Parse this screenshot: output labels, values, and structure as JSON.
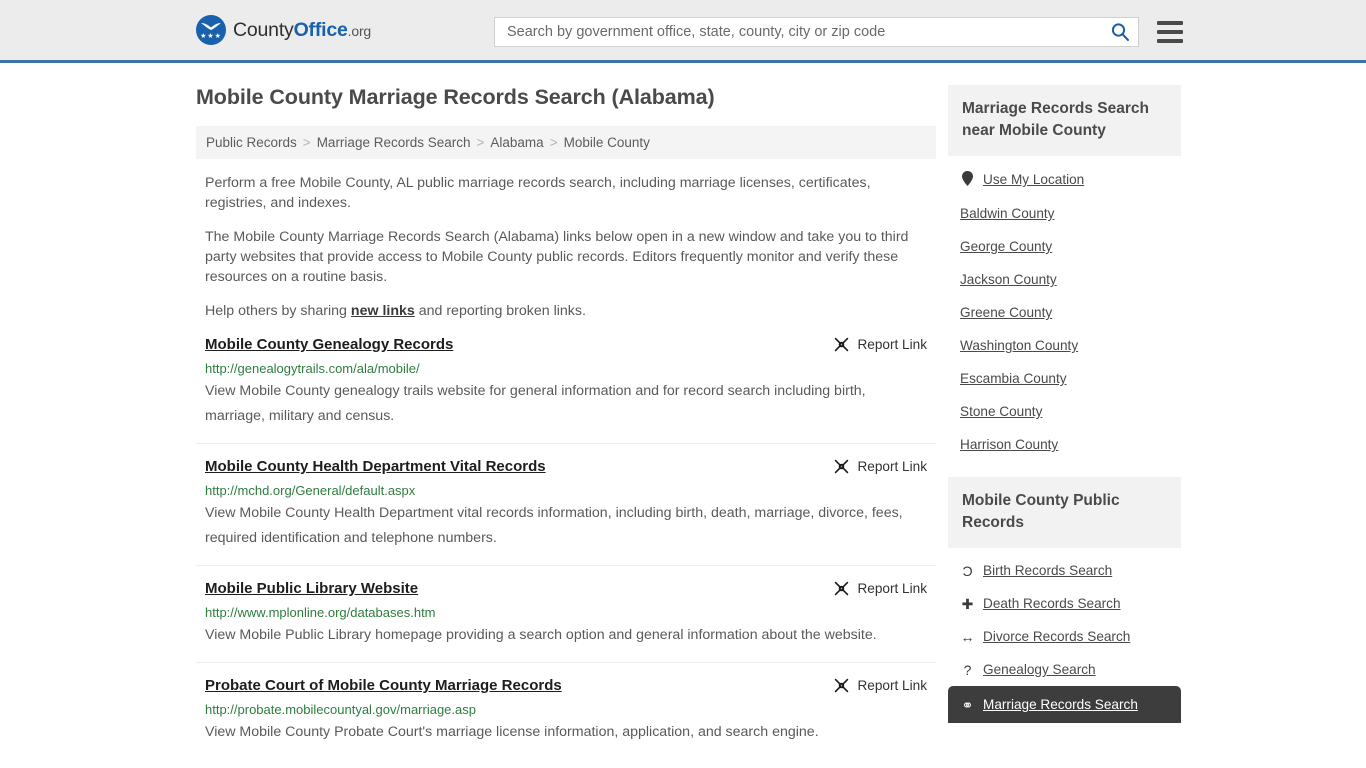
{
  "header": {
    "logo": {
      "name_part1": "County",
      "name_part2": "Office",
      "tld": ".org"
    },
    "search": {
      "placeholder": "Search by government office, state, county, city or zip code",
      "value": "",
      "search_icon": "search-icon",
      "menu_icon": "hamburger-menu-icon"
    }
  },
  "main": {
    "page_title": "Mobile County Marriage Records Search (Alabama)",
    "breadcrumb": [
      {
        "label": "Public Records",
        "current": false
      },
      {
        "label": "Marriage Records Search",
        "current": false
      },
      {
        "label": "Alabama",
        "current": false
      },
      {
        "label": "Mobile County",
        "current": true
      }
    ],
    "breadcrumb_separator": ">",
    "paragraphs": {
      "p1": "Perform a free Mobile County, AL public marriage records search, including marriage licenses, certificates, registries, and indexes.",
      "p2": "The Mobile County Marriage Records Search (Alabama) links below open in a new window and take you to third party websites that provide access to Mobile County public records. Editors frequently monitor and verify these resources on a routine basis.",
      "p3_before": "Help others by sharing ",
      "p3_link": "new links",
      "p3_after": " and reporting broken links."
    },
    "report_link_label": "Report Link",
    "report_link_icon": "broken-link-icon",
    "results": [
      {
        "title": "Mobile County Genealogy Records",
        "url": "http://genealogytrails.com/ala/mobile/",
        "description": "View Mobile County genealogy trails website for general information and for record search including birth, marriage, military and census."
      },
      {
        "title": "Mobile County Health Department Vital Records",
        "url": "http://mchd.org/General/default.aspx",
        "description": "View Mobile County Health Department vital records information, including birth, death, marriage, divorce, fees, required identification and telephone numbers."
      },
      {
        "title": "Mobile Public Library Website",
        "url": "http://www.mplonline.org/databases.htm",
        "description": "View Mobile Public Library homepage providing a search option and general information about the website."
      },
      {
        "title": "Probate Court of Mobile County Marriage Records",
        "url": "http://probate.mobilecountyal.gov/marriage.asp",
        "description": "View Mobile County Probate Court's marriage license information, application, and search engine."
      }
    ]
  },
  "sidebar": {
    "nearby": {
      "title": "Marriage Records Search near Mobile County",
      "items": [
        {
          "label": "Use My Location",
          "icon": "map-pin-icon",
          "active": false
        },
        {
          "label": "Baldwin County",
          "icon": "",
          "active": false
        },
        {
          "label": "George County",
          "icon": "",
          "active": false
        },
        {
          "label": "Jackson County",
          "icon": "",
          "active": false
        },
        {
          "label": "Greene County",
          "icon": "",
          "active": false
        },
        {
          "label": "Washington County",
          "icon": "",
          "active": false
        },
        {
          "label": "Escambia County",
          "icon": "",
          "active": false
        },
        {
          "label": "Stone County",
          "icon": "",
          "active": false
        },
        {
          "label": "Harrison County",
          "icon": "",
          "active": false
        }
      ]
    },
    "public_records": {
      "title": "Mobile County Public Records",
      "items": [
        {
          "label": "Birth Records Search",
          "icon": "baby-icon",
          "glyph": "Ɔ",
          "active": false
        },
        {
          "label": "Death Records Search",
          "icon": "cross-icon",
          "glyph": "✚",
          "active": false
        },
        {
          "label": "Divorce Records Search",
          "icon": "double-arrow-icon",
          "glyph": "↔",
          "active": false
        },
        {
          "label": "Genealogy Search",
          "icon": "question-mark-icon",
          "glyph": "?",
          "active": false
        },
        {
          "label": "Marriage Records Search",
          "icon": "rings-icon",
          "glyph": "⚭",
          "active": true
        }
      ]
    }
  },
  "colors": {
    "brand_blue": "#1961ac",
    "header_bg": "#ececec",
    "header_border": "#3b72a8",
    "breadcrumb_bg": "#f4f4f4",
    "url_green": "#2f7d3e",
    "sidebar_head_bg": "#f2f2f2",
    "active_item_bg": "#3d3d3d",
    "body_text": "#5a5a5a"
  }
}
